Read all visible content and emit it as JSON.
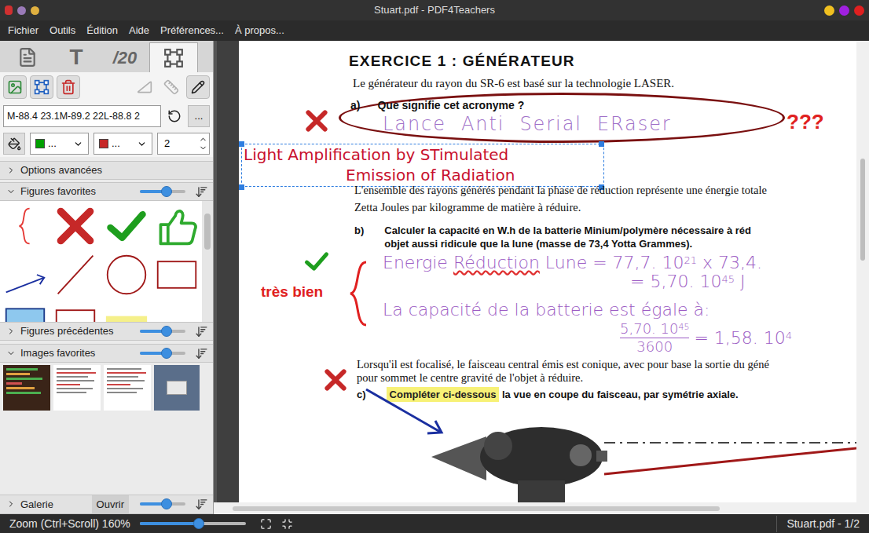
{
  "window": {
    "title": "Stuart.pdf - PDF4Teachers"
  },
  "menu": [
    "Fichier",
    "Outils",
    "Édition",
    "Aide",
    "Préférences...",
    "À propos..."
  ],
  "sidebar": {
    "tabs": [
      {
        "kind": "pdf",
        "selected": false
      },
      {
        "kind": "glyph",
        "label": "T",
        "selected": false
      },
      {
        "kind": "glyph",
        "label": "/20",
        "selected": false
      },
      {
        "kind": "vector",
        "selected": true
      }
    ],
    "tools": [
      {
        "kind": "image",
        "disabled": false
      },
      {
        "kind": "shape",
        "disabled": false
      },
      {
        "kind": "delete",
        "disabled": false
      },
      {
        "kind": "square-ruler",
        "disabled": true
      },
      {
        "kind": "ruler",
        "disabled": true
      },
      {
        "kind": "pencil",
        "disabled": false
      }
    ],
    "path": {
      "value": "M-88.4 23.1M-89.2 22L-88.8 2",
      "button": "..."
    },
    "fill_color": {
      "value": "...",
      "color": "#00a000"
    },
    "stroke_color": {
      "value": "...",
      "color": "#c62828"
    },
    "stroke_width": "2",
    "sections": [
      {
        "kind": "plain",
        "label": "Options avancées",
        "expanded": false
      },
      {
        "kind": "figures",
        "label": "Figures favorites",
        "expanded": true,
        "level": 0.58,
        "figures": [
          {
            "kind": "brace",
            "color": "#e53935"
          },
          {
            "kind": "cross",
            "color": "#c62828"
          },
          {
            "kind": "check",
            "color": "#1e9e1e"
          },
          {
            "kind": "thumb",
            "color": "#2eaa2e"
          },
          {
            "kind": "arrow",
            "color": "#1a2fa0"
          },
          {
            "kind": "line",
            "color": "#a01818"
          },
          {
            "kind": "circle",
            "color": "#a01818"
          },
          {
            "kind": "rect",
            "color": "#a01818"
          },
          {
            "kind": "filled-rect",
            "color": "#8ec8ee"
          },
          {
            "kind": "rect",
            "color": "#a01818"
          },
          {
            "kind": "highlight",
            "color": "#f5f08a"
          }
        ]
      },
      {
        "kind": "previous",
        "label": "Figures précédentes",
        "expanded": false,
        "level": 0.58
      },
      {
        "kind": "images",
        "label": "Images favorites",
        "expanded": true,
        "level": 0.58,
        "images": [
          {
            "kind": "dark"
          },
          {
            "kind": "doc"
          },
          {
            "kind": "doc"
          },
          {
            "kind": "dialog"
          }
        ]
      },
      {
        "kind": "gallery",
        "label": "Galerie",
        "expanded": false,
        "button": "Ouvrir",
        "level": 0.58
      }
    ]
  },
  "document": {
    "title": "EXERCICE 1 : GÉNÉRATEUR",
    "intro": "Le générateur du rayon du SR-6 est basé sur la technologie LASER.",
    "qa": {
      "label": "a)",
      "text": "Que signifie cet acronyme  ?",
      "answer": "Lance  Anti  Serial  ERaser",
      "correct": false,
      "comment": "???",
      "correction": [
        "Light Amplification by STimulated",
        "Emission of Radiation"
      ]
    },
    "para_b": [
      "L'ensemble des rayons générés pendant la phase de réduction représente une énergie totale",
      "Zetta Joules par kilogramme de matière à réduire."
    ],
    "qb": {
      "label": "b)",
      "lines": [
        "Calculer la capacité en W.h de la batterie Minium/polymère nécessaire à réd",
        "objet aussi ridicule que la lune (masse de 73,4 Yotta Grammes)."
      ],
      "correct": true,
      "comment": "très bien",
      "answer": [
        [
          {
            "kind": "text",
            "t": "Energie "
          },
          {
            "kind": "spell",
            "t": "Réduction"
          },
          {
            "kind": "text",
            "t": " Lune = 77,7. 10"
          },
          {
            "kind": "sup",
            "t": "21"
          },
          {
            "kind": "text",
            "t": " x 73,4."
          }
        ],
        [
          {
            "kind": "text",
            "t": "= 5,70. 10"
          },
          {
            "kind": "sup",
            "t": "45"
          },
          {
            "kind": "text",
            "t": " J"
          }
        ],
        [
          {
            "kind": "text",
            "t": "La capacité de la batterie est égale à:"
          }
        ]
      ],
      "fraction": {
        "numerator": "5,70. 10",
        "numerator_sup": "45",
        "denominator": "3600",
        "result": "= 1,58. 10",
        "result_sup": "4"
      }
    },
    "para_c": [
      "Lorsqu'il est focalisé, le faisceau central émis est conique, avec pour base la sortie du géné",
      "pour sommet le centre gravité de l'objet à réduire."
    ],
    "qc": {
      "label": "c)",
      "highlight": "Compléter ci-dessous",
      "text": " la vue en coupe du faisceau, par symétrie axiale.",
      "correct": false
    }
  },
  "status_bar": {
    "zoom": "Zoom (Ctrl+Scroll) 160%",
    "zoom_level": 0.56,
    "file": "Stuart.pdf - 1/2"
  }
}
